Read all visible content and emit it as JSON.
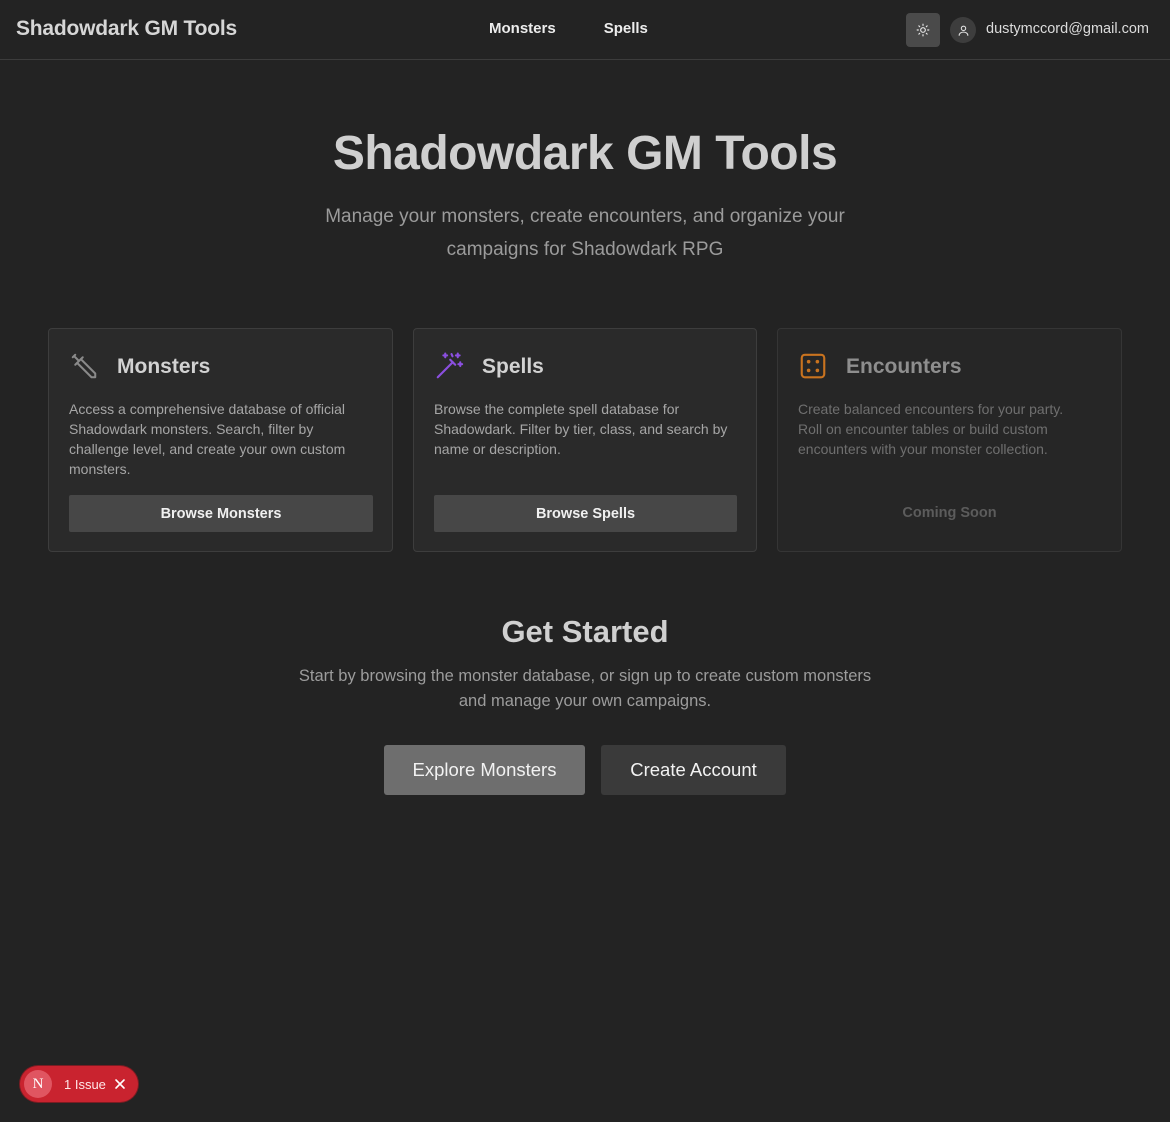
{
  "header": {
    "brand": "Shadowdark GM Tools",
    "nav": [
      {
        "label": "Monsters"
      },
      {
        "label": "Spells"
      }
    ],
    "theme_toggle_icon": "sun-icon",
    "user_icon": "user-icon",
    "user_email": "dustymccord@gmail.com"
  },
  "hero": {
    "title": "Shadowdark GM Tools",
    "subtitle": "Manage your monsters, create encounters, and organize your campaigns for Shadowdark RPG"
  },
  "cards": [
    {
      "icon": "sword-icon",
      "title": "Monsters",
      "description": "Access a comprehensive database of official Shadowdark monsters. Search, filter by challenge level, and create your own custom monsters.",
      "button": "Browse Monsters"
    },
    {
      "icon": "magic-wand-icon",
      "title": "Spells",
      "description": "Browse the complete spell database for Shadowdark. Filter by tier, class, and search by name or description.",
      "button": "Browse Spells"
    },
    {
      "icon": "dice-icon",
      "title": "Encounters",
      "description": "Create balanced encounters for your party. Roll on encounter tables or build custom encounters with your monster collection.",
      "status": "Coming Soon"
    }
  ],
  "get_started": {
    "title": "Get Started",
    "text": "Start by browsing the monster database, or sign up to create custom monsters and manage your own campaigns.",
    "primary_button": "Explore Monsters",
    "secondary_button": "Create Account"
  },
  "issue_badge": {
    "logo": "N",
    "text": "1 Issue"
  },
  "colors": {
    "background": "#232323",
    "spells_icon": "#8b4fe0",
    "encounters_icon": "#c9731f",
    "issue_badge": "#c9232f"
  }
}
